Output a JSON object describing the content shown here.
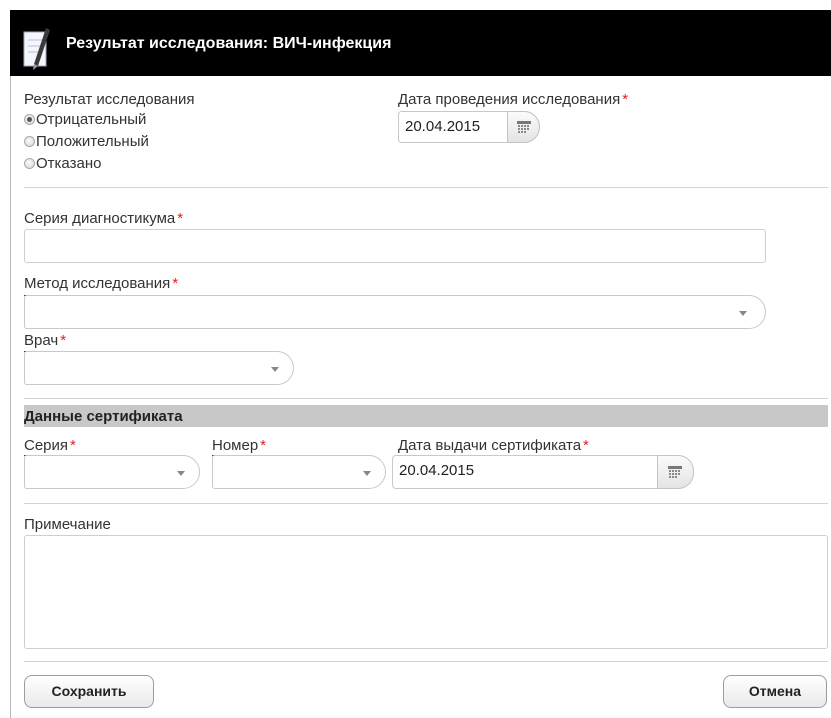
{
  "dialog": {
    "title": "Результат исследования: ВИЧ-инфекция"
  },
  "result": {
    "label": "Результат исследования",
    "options": [
      {
        "label": "Отрицательный",
        "checked": true
      },
      {
        "label": "Положительный",
        "checked": false
      },
      {
        "label": "Отказано",
        "checked": false
      }
    ]
  },
  "study_date": {
    "label": "Дата проведения исследования",
    "required_mark": "*",
    "value": "20.04.2015"
  },
  "diagnosticum_series": {
    "label": "Серия диагностикума",
    "required_mark": "*",
    "value": ""
  },
  "method": {
    "label": "Метод исследования",
    "required_mark": "*",
    "value": ""
  },
  "doctor": {
    "label": "Врач",
    "required_mark": "*",
    "value": ""
  },
  "certificate": {
    "section_title": "Данные сертификата",
    "series": {
      "label": "Серия",
      "required_mark": "*",
      "value": ""
    },
    "number": {
      "label": "Номер",
      "required_mark": "*",
      "value": ""
    },
    "issue_date": {
      "label": "Дата выдачи сертификата",
      "required_mark": "*",
      "value": "20.04.2015"
    }
  },
  "note": {
    "label": "Примечание",
    "value": ""
  },
  "buttons": {
    "save_label": "Сохранить",
    "cancel_label": "Отмена"
  },
  "icons": {
    "title": "pencil-document-icon",
    "calendar": "calendar-icon",
    "dropdown": "chevron-down-icon"
  },
  "colors": {
    "titlebar_bg": "#000000",
    "required_mark": "#dd2222",
    "section_bar": "#c8c8c8"
  }
}
